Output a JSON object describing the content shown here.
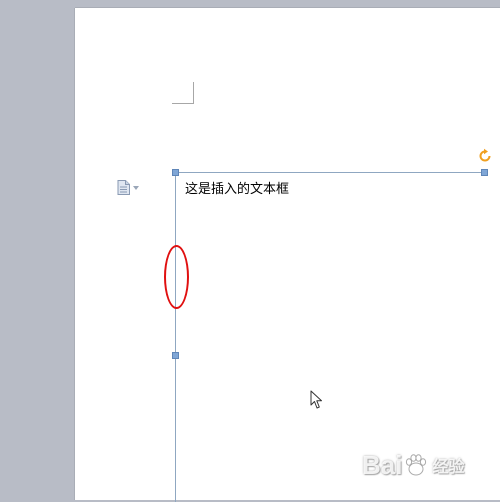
{
  "document": {
    "textbox": {
      "text": "这是插入的文本框"
    }
  },
  "watermark": {
    "brand_part1": "Bai",
    "brand_part2": "经验"
  },
  "icons": {
    "paste_options": "document-icon",
    "rotate": "rotate-icon",
    "cursor": "arrow-cursor-icon"
  },
  "colors": {
    "workspace": "#b8bcc6",
    "page": "#ffffff",
    "selection_border": "#8fa7c1",
    "handle": "#7fa6d6",
    "rotate_handle": "#f0a020",
    "annotation": "#e01010"
  }
}
